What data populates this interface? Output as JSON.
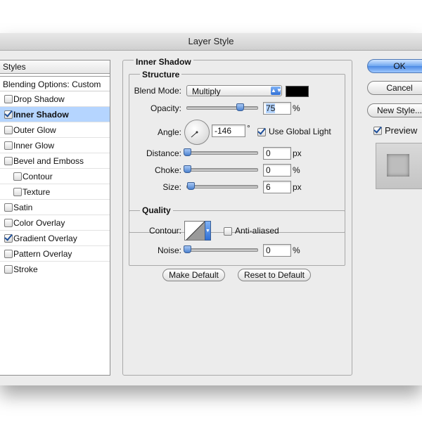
{
  "window": {
    "title": "Layer Style"
  },
  "styles_list": {
    "header": "Styles",
    "blending_options": "Blending Options: Custom",
    "items": [
      {
        "label": "Drop Shadow",
        "checked": false,
        "selected": false
      },
      {
        "label": "Inner Shadow",
        "checked": true,
        "selected": true
      },
      {
        "label": "Outer Glow",
        "checked": false,
        "selected": false
      },
      {
        "label": "Inner Glow",
        "checked": false,
        "selected": false
      },
      {
        "label": "Bevel and Emboss",
        "checked": false,
        "selected": false
      },
      {
        "label": "Contour",
        "checked": false,
        "selected": false
      },
      {
        "label": "Texture",
        "checked": false,
        "selected": false
      },
      {
        "label": "Satin",
        "checked": false,
        "selected": false
      },
      {
        "label": "Color Overlay",
        "checked": false,
        "selected": false
      },
      {
        "label": "Gradient Overlay",
        "checked": true,
        "selected": false
      },
      {
        "label": "Pattern Overlay",
        "checked": false,
        "selected": false
      },
      {
        "label": "Stroke",
        "checked": false,
        "selected": false
      }
    ]
  },
  "panel": {
    "title": "Inner Shadow",
    "structure": {
      "title": "Structure",
      "blend_mode_label": "Blend Mode:",
      "blend_mode_value": "Multiply",
      "blend_color": "#000000",
      "opacity_label": "Opacity:",
      "opacity_value": "75",
      "opacity_unit": "%",
      "angle_label": "Angle:",
      "angle_value": "-146",
      "angle_unit": "°",
      "use_global_light_label": "Use Global Light",
      "use_global_light_checked": true,
      "distance_label": "Distance:",
      "distance_value": "0",
      "distance_unit": "px",
      "choke_label": "Choke:",
      "choke_value": "0",
      "choke_unit": "%",
      "size_label": "Size:",
      "size_value": "6",
      "size_unit": "px"
    },
    "quality": {
      "title": "Quality",
      "contour_label": "Contour:",
      "anti_aliased_label": "Anti-aliased",
      "anti_aliased_checked": false,
      "noise_label": "Noise:",
      "noise_value": "0",
      "noise_unit": "%"
    },
    "make_default_label": "Make Default",
    "reset_default_label": "Reset to Default"
  },
  "buttons": {
    "ok_label": "OK",
    "cancel_label": "Cancel",
    "new_style_label": "New Style...",
    "preview_label": "Preview",
    "preview_checked": true
  },
  "colors": {
    "selection": "#b5d5ff",
    "accent": "#4c8ae4"
  }
}
